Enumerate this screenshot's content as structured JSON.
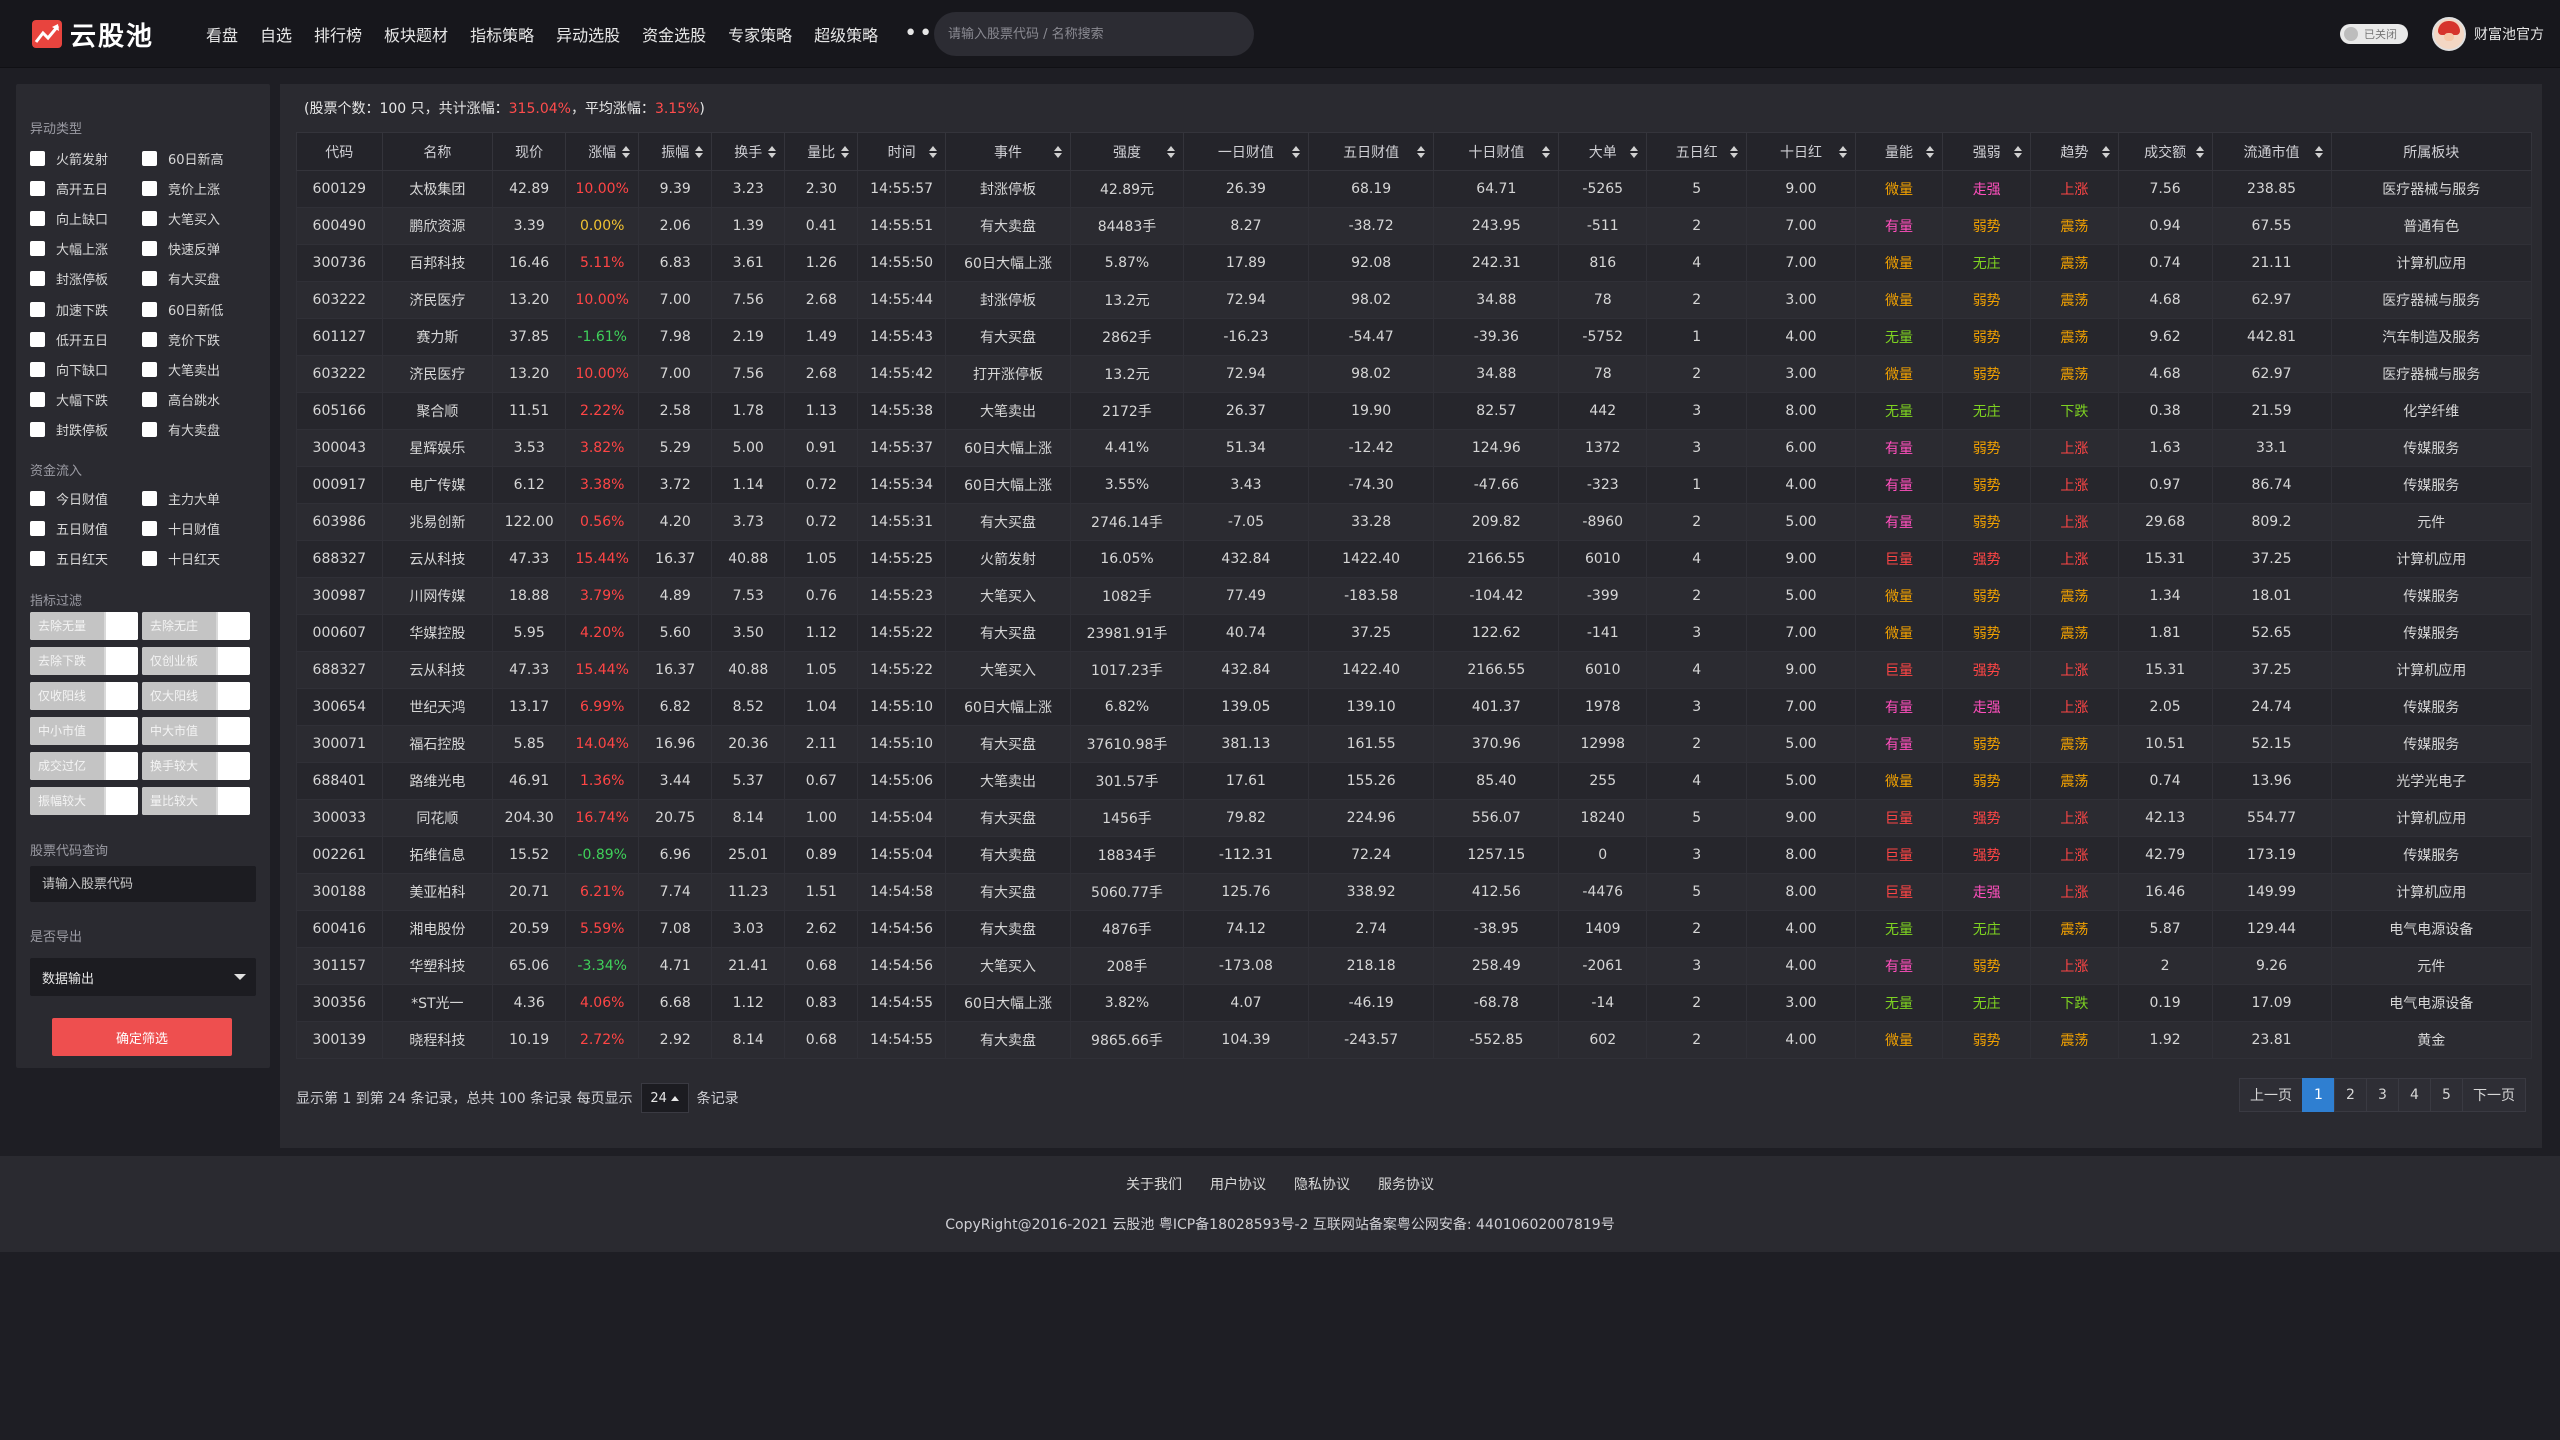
{
  "app": {
    "logo_text": "云股池",
    "nav": [
      "看盘",
      "自选",
      "排行榜",
      "板块题材",
      "指标策略",
      "异动选股",
      "资金选股",
      "专家策略",
      "超级策略"
    ],
    "nav_more": "•••",
    "search_placeholder": "请输入股票代码 / 名称搜索",
    "toggle_label": "已关闭",
    "user_name": "财富池官方"
  },
  "sidebar": {
    "section_abnormal": "异动类型",
    "abnormal_items": [
      [
        "火箭发射",
        "60日新高"
      ],
      [
        "高开五日",
        "竞价上涨"
      ],
      [
        "向上缺口",
        "大笔买入"
      ],
      [
        "大幅上涨",
        "快速反弹"
      ],
      [
        "封涨停板",
        "有大买盘"
      ],
      [
        "加速下跌",
        "60日新低"
      ],
      [
        "低开五日",
        "竞价下跌"
      ],
      [
        "向下缺口",
        "大笔卖出"
      ],
      [
        "大幅下跌",
        "高台跳水"
      ],
      [
        "封跌停板",
        "有大卖盘"
      ]
    ],
    "section_capital": "资金流入",
    "capital_items": [
      [
        "今日财值",
        "主力大单"
      ],
      [
        "五日财值",
        "十日财值"
      ],
      [
        "五日红天",
        "十日红天"
      ]
    ],
    "section_indicator": "指标过滤",
    "indicator_items": [
      [
        "去除无量",
        "去除无庄"
      ],
      [
        "去除下跌",
        "仅创业板"
      ],
      [
        "仅收阳线",
        "仅大阳线"
      ],
      [
        "中小市值",
        "中大市值"
      ],
      [
        "成交过亿",
        "换手较大"
      ],
      [
        "振幅较大",
        "量比较大"
      ]
    ],
    "section_query": "股票代码查询",
    "code_placeholder": "请输入股票代码",
    "section_export": "是否导出",
    "export_value": "数据输出",
    "confirm_label": "确定筛选"
  },
  "summary": {
    "prefix": "(股票个数：100 只，共计涨幅：",
    "total_gain": "315.04%",
    "middle": "，平均涨幅：",
    "avg_gain": "3.15%",
    "suffix": ")"
  },
  "table": {
    "columns": [
      {
        "label": "代码",
        "sort": false
      },
      {
        "label": "名称",
        "sort": false
      },
      {
        "label": "现价",
        "sort": false
      },
      {
        "label": "涨幅",
        "sort": true
      },
      {
        "label": "振幅",
        "sort": true
      },
      {
        "label": "换手",
        "sort": true
      },
      {
        "label": "量比",
        "sort": true
      },
      {
        "label": "时间",
        "sort": true
      },
      {
        "label": "事件",
        "sort": true
      },
      {
        "label": "强度",
        "sort": true
      },
      {
        "label": "一日财值",
        "sort": true
      },
      {
        "label": "五日财值",
        "sort": true
      },
      {
        "label": "十日财值",
        "sort": true
      },
      {
        "label": "大单",
        "sort": true
      },
      {
        "label": "五日红",
        "sort": true
      },
      {
        "label": "十日红",
        "sort": true
      },
      {
        "label": "量能",
        "sort": true
      },
      {
        "label": "强弱",
        "sort": true
      },
      {
        "label": "趋势",
        "sort": true
      },
      {
        "label": "成交额",
        "sort": true
      },
      {
        "label": "流通市值",
        "sort": true
      },
      {
        "label": "所属板块",
        "sort": false
      }
    ],
    "rows": [
      [
        "600129",
        "太极集团",
        "42.89",
        "10.00%",
        "9.39",
        "3.23",
        "2.30",
        "14:55:57",
        "封涨停板",
        "42.89元",
        "26.39",
        "68.19",
        "64.71",
        "-5265",
        "5",
        "9.00",
        "微量",
        "走强",
        "上涨",
        "7.56",
        "238.85",
        "医疗器械与服务"
      ],
      [
        "600490",
        "鹏欣资源",
        "3.39",
        "0.00%",
        "2.06",
        "1.39",
        "0.41",
        "14:55:51",
        "有大卖盘",
        "84483手",
        "8.27",
        "-38.72",
        "243.95",
        "-511",
        "2",
        "7.00",
        "有量",
        "弱势",
        "震荡",
        "0.94",
        "67.55",
        "普通有色"
      ],
      [
        "300736",
        "百邦科技",
        "16.46",
        "5.11%",
        "6.83",
        "3.61",
        "1.26",
        "14:55:50",
        "60日大幅上涨",
        "5.87%",
        "17.89",
        "92.08",
        "242.31",
        "816",
        "4",
        "7.00",
        "微量",
        "无庄",
        "震荡",
        "0.74",
        "21.11",
        "计算机应用"
      ],
      [
        "603222",
        "济民医疗",
        "13.20",
        "10.00%",
        "7.00",
        "7.56",
        "2.68",
        "14:55:44",
        "封涨停板",
        "13.2元",
        "72.94",
        "98.02",
        "34.88",
        "78",
        "2",
        "3.00",
        "微量",
        "弱势",
        "震荡",
        "4.68",
        "62.97",
        "医疗器械与服务"
      ],
      [
        "601127",
        "赛力斯",
        "37.85",
        "-1.61%",
        "7.98",
        "2.19",
        "1.49",
        "14:55:43",
        "有大买盘",
        "2862手",
        "-16.23",
        "-54.47",
        "-39.36",
        "-5752",
        "1",
        "4.00",
        "无量",
        "弱势",
        "震荡",
        "9.62",
        "442.81",
        "汽车制造及服务"
      ],
      [
        "603222",
        "济民医疗",
        "13.20",
        "10.00%",
        "7.00",
        "7.56",
        "2.68",
        "14:55:42",
        "打开涨停板",
        "13.2元",
        "72.94",
        "98.02",
        "34.88",
        "78",
        "2",
        "3.00",
        "微量",
        "弱势",
        "震荡",
        "4.68",
        "62.97",
        "医疗器械与服务"
      ],
      [
        "605166",
        "聚合顺",
        "11.51",
        "2.22%",
        "2.58",
        "1.78",
        "1.13",
        "14:55:38",
        "大笔卖出",
        "2172手",
        "26.37",
        "19.90",
        "82.57",
        "442",
        "3",
        "8.00",
        "无量",
        "无庄",
        "下跌",
        "0.38",
        "21.59",
        "化学纤维"
      ],
      [
        "300043",
        "星辉娱乐",
        "3.53",
        "3.82%",
        "5.29",
        "5.00",
        "0.91",
        "14:55:37",
        "60日大幅上涨",
        "4.41%",
        "51.34",
        "-12.42",
        "124.96",
        "1372",
        "3",
        "6.00",
        "有量",
        "弱势",
        "上涨",
        "1.63",
        "33.1",
        "传媒服务"
      ],
      [
        "000917",
        "电广传媒",
        "6.12",
        "3.38%",
        "3.72",
        "1.14",
        "0.72",
        "14:55:34",
        "60日大幅上涨",
        "3.55%",
        "3.43",
        "-74.30",
        "-47.66",
        "-323",
        "1",
        "4.00",
        "有量",
        "弱势",
        "上涨",
        "0.97",
        "86.74",
        "传媒服务"
      ],
      [
        "603986",
        "兆易创新",
        "122.00",
        "0.56%",
        "4.20",
        "3.73",
        "0.72",
        "14:55:31",
        "有大买盘",
        "2746.14手",
        "-7.05",
        "33.28",
        "209.82",
        "-8960",
        "2",
        "5.00",
        "有量",
        "弱势",
        "上涨",
        "29.68",
        "809.2",
        "元件"
      ],
      [
        "688327",
        "云从科技",
        "47.33",
        "15.44%",
        "16.37",
        "40.88",
        "1.05",
        "14:55:25",
        "火箭发射",
        "16.05%",
        "432.84",
        "1422.40",
        "2166.55",
        "6010",
        "4",
        "9.00",
        "巨量",
        "强势",
        "上涨",
        "15.31",
        "37.25",
        "计算机应用"
      ],
      [
        "300987",
        "川网传媒",
        "18.88",
        "3.79%",
        "4.89",
        "7.53",
        "0.76",
        "14:55:23",
        "大笔买入",
        "1082手",
        "77.49",
        "-183.58",
        "-104.42",
        "-399",
        "2",
        "5.00",
        "微量",
        "弱势",
        "震荡",
        "1.34",
        "18.01",
        "传媒服务"
      ],
      [
        "000607",
        "华媒控股",
        "5.95",
        "4.20%",
        "5.60",
        "3.50",
        "1.12",
        "14:55:22",
        "有大买盘",
        "23981.91手",
        "40.74",
        "37.25",
        "122.62",
        "-141",
        "3",
        "7.00",
        "微量",
        "弱势",
        "震荡",
        "1.81",
        "52.65",
        "传媒服务"
      ],
      [
        "688327",
        "云从科技",
        "47.33",
        "15.44%",
        "16.37",
        "40.88",
        "1.05",
        "14:55:22",
        "大笔买入",
        "1017.23手",
        "432.84",
        "1422.40",
        "2166.55",
        "6010",
        "4",
        "9.00",
        "巨量",
        "强势",
        "上涨",
        "15.31",
        "37.25",
        "计算机应用"
      ],
      [
        "300654",
        "世纪天鸿",
        "13.17",
        "6.99%",
        "6.82",
        "8.52",
        "1.04",
        "14:55:10",
        "60日大幅上涨",
        "6.82%",
        "139.05",
        "139.10",
        "401.37",
        "1978",
        "3",
        "7.00",
        "有量",
        "走强",
        "上涨",
        "2.05",
        "24.74",
        "传媒服务"
      ],
      [
        "300071",
        "福石控股",
        "5.85",
        "14.04%",
        "16.96",
        "20.36",
        "2.11",
        "14:55:10",
        "有大买盘",
        "37610.98手",
        "381.13",
        "161.55",
        "370.96",
        "12998",
        "2",
        "5.00",
        "有量",
        "弱势",
        "震荡",
        "10.51",
        "52.15",
        "传媒服务"
      ],
      [
        "688401",
        "路维光电",
        "46.91",
        "1.36%",
        "3.44",
        "5.37",
        "0.67",
        "14:55:06",
        "大笔卖出",
        "301.57手",
        "17.61",
        "155.26",
        "85.40",
        "255",
        "4",
        "5.00",
        "微量",
        "弱势",
        "震荡",
        "0.74",
        "13.96",
        "光学光电子"
      ],
      [
        "300033",
        "同花顺",
        "204.30",
        "16.74%",
        "20.75",
        "8.14",
        "1.00",
        "14:55:04",
        "有大买盘",
        "1456手",
        "79.82",
        "224.96",
        "556.07",
        "18240",
        "5",
        "9.00",
        "巨量",
        "强势",
        "上涨",
        "42.13",
        "554.77",
        "计算机应用"
      ],
      [
        "002261",
        "拓维信息",
        "15.52",
        "-0.89%",
        "6.96",
        "25.01",
        "0.89",
        "14:55:04",
        "有大卖盘",
        "18834手",
        "-112.31",
        "72.24",
        "1257.15",
        "0",
        "3",
        "8.00",
        "巨量",
        "强势",
        "上涨",
        "42.79",
        "173.19",
        "传媒服务"
      ],
      [
        "300188",
        "美亚柏科",
        "20.71",
        "6.21%",
        "7.74",
        "11.23",
        "1.51",
        "14:54:58",
        "有大买盘",
        "5060.77手",
        "125.76",
        "338.92",
        "412.56",
        "-4476",
        "5",
        "8.00",
        "巨量",
        "走强",
        "上涨",
        "16.46",
        "149.99",
        "计算机应用"
      ],
      [
        "600416",
        "湘电股份",
        "20.59",
        "5.59%",
        "7.08",
        "3.03",
        "2.62",
        "14:54:56",
        "有大卖盘",
        "4876手",
        "74.12",
        "2.74",
        "-38.95",
        "1409",
        "2",
        "4.00",
        "无量",
        "无庄",
        "震荡",
        "5.87",
        "129.44",
        "电气电源设备"
      ],
      [
        "301157",
        "华塑科技",
        "65.06",
        "-3.34%",
        "4.71",
        "21.41",
        "0.68",
        "14:54:56",
        "大笔买入",
        "208手",
        "-173.08",
        "218.18",
        "258.49",
        "-2061",
        "3",
        "4.00",
        "有量",
        "弱势",
        "上涨",
        "2",
        "9.26",
        "元件"
      ],
      [
        "300356",
        "*ST光一",
        "4.36",
        "4.06%",
        "6.68",
        "1.12",
        "0.83",
        "14:54:55",
        "60日大幅上涨",
        "3.82%",
        "4.07",
        "-46.19",
        "-68.78",
        "-14",
        "2",
        "3.00",
        "无量",
        "无庄",
        "下跌",
        "0.19",
        "17.09",
        "电气电源设备"
      ],
      [
        "300139",
        "晓程科技",
        "10.19",
        "2.72%",
        "2.92",
        "8.14",
        "0.68",
        "14:54:55",
        "有大卖盘",
        "9865.66手",
        "104.39",
        "-243.57",
        "-552.85",
        "602",
        "2",
        "4.00",
        "微量",
        "弱势",
        "震荡",
        "1.92",
        "23.81",
        "黄金"
      ]
    ]
  },
  "pager": {
    "info_prefix": "显示第 1 到第 24 条记录，总共 100 条记录  每页显示",
    "page_size": "24",
    "info_suffix": "条记录",
    "prev": "上一页",
    "pages": [
      "1",
      "2",
      "3",
      "4",
      "5"
    ],
    "active": "1",
    "next": "下一页"
  },
  "footer": {
    "links": [
      "关于我们",
      "用户协议",
      "隐私协议",
      "服务协议"
    ],
    "copyright": "CopyRight@2016-2021 云股池 粤ICP备18028593号-2 互联网站备案粤公网安备: 44010602007819号"
  },
  "colors": {
    "up": "#ff4545",
    "down": "#3fd15a",
    "accent": "#ee4f4f",
    "active_page": "#2f7fd1"
  }
}
